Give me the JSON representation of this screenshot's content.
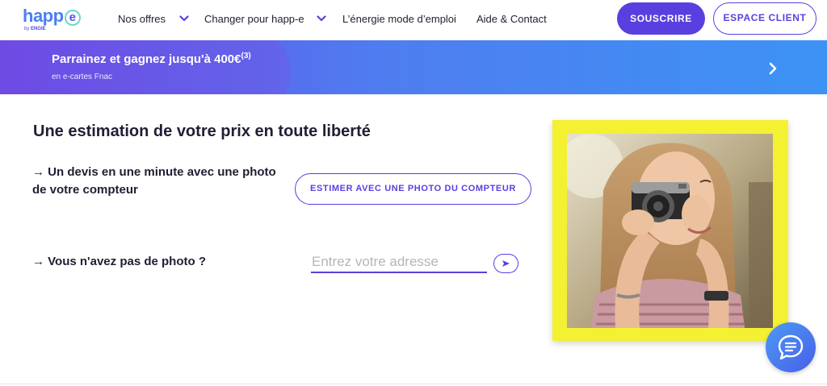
{
  "header": {
    "logo": {
      "word": "happ",
      "e": "e",
      "sub_prefix": "by",
      "sub_brand": "ENGIE"
    },
    "nav": [
      {
        "label": "Nos offres",
        "has_dropdown": true
      },
      {
        "label": "Changer pour happ-e",
        "has_dropdown": true
      },
      {
        "label": "L’énergie mode d’emploi",
        "has_dropdown": false
      },
      {
        "label": "Aide & Contact",
        "has_dropdown": false
      }
    ],
    "souscrire_label": "SOUSCRIRE",
    "espace_label": "ESPACE CLIENT"
  },
  "banner": {
    "title": "Parrainez et gagnez jusqu'à 400€",
    "title_note": "(3)",
    "subtitle": "en e-cartes Fnac",
    "arrow_icon": "chevron-right-icon"
  },
  "main": {
    "title": "Une estimation de votre prix en toute liberté",
    "item1": "→ Un devis en une minute avec une photo de votre compteur",
    "estimer_label": "ESTIMER AVEC UNE PHOTO DU COMPTEUR",
    "item2": "→ Vous n'avez pas de photo ?",
    "address_placeholder": "Entrez votre adresse",
    "address_value": ""
  },
  "colors": {
    "accent": "#5a3fe0",
    "banner_start": "#6a48e4",
    "banner_end": "#3d93f5",
    "photo_frame": "#f4f032",
    "chat": "#4a7ff0"
  },
  "icons": {
    "dropdown": "chevron-down-icon",
    "address_submit": "arrow-right-icon",
    "chat": "chat-bubble-icon"
  }
}
